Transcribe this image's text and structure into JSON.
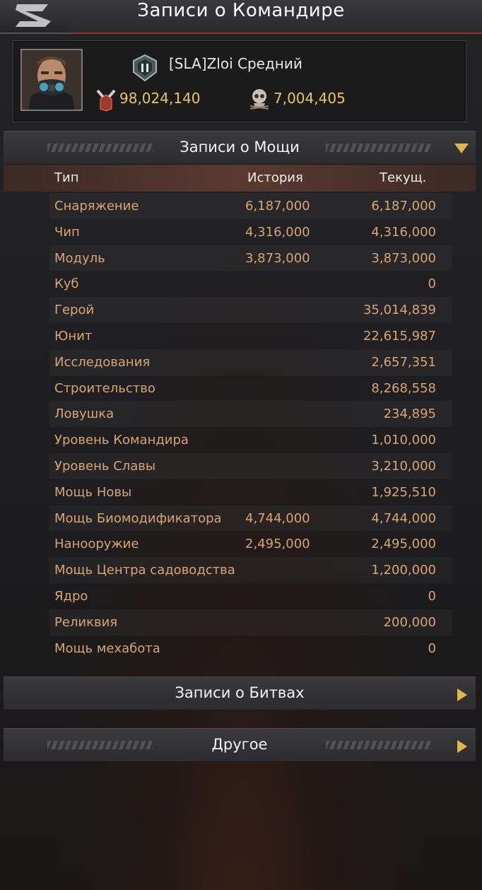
{
  "header": {
    "title": "Записи о Командире"
  },
  "profile": {
    "name": "[SLA]Zloi Средний",
    "power": "98,024,140",
    "kills": "7,004,405"
  },
  "power_section": {
    "title": "Записи о Мощи",
    "columns": {
      "type": "Тип",
      "history": "История",
      "current": "Текущ."
    },
    "rows": [
      {
        "type": "Снаряжение",
        "history": "6,187,000",
        "current": "6,187,000"
      },
      {
        "type": "Чип",
        "history": "4,316,000",
        "current": "4,316,000"
      },
      {
        "type": "Модуль",
        "history": "3,873,000",
        "current": "3,873,000"
      },
      {
        "type": "Куб",
        "history": "",
        "current": "0"
      },
      {
        "type": "Герой",
        "history": "",
        "current": "35,014,839"
      },
      {
        "type": "Юнит",
        "history": "",
        "current": "22,615,987"
      },
      {
        "type": "Исследования",
        "history": "",
        "current": "2,657,351"
      },
      {
        "type": "Строительство",
        "history": "",
        "current": "8,268,558"
      },
      {
        "type": "Ловушка",
        "history": "",
        "current": "234,895"
      },
      {
        "type": "Уровень Командира",
        "history": "",
        "current": "1,010,000"
      },
      {
        "type": "Уровень Славы",
        "history": "",
        "current": "3,210,000"
      },
      {
        "type": "Мощь Новы",
        "history": "",
        "current": "1,925,510"
      },
      {
        "type": "Мощь Биомодификатора",
        "history": "4,744,000",
        "current": "4,744,000"
      },
      {
        "type": "Нанооружие",
        "history": "2,495,000",
        "current": "2,495,000"
      },
      {
        "type": "Мощь Центра садоводства",
        "history": "",
        "current": "1,200,000"
      },
      {
        "type": "Ядро",
        "history": "",
        "current": "0"
      },
      {
        "type": "Реликвия",
        "history": "",
        "current": "200,000"
      },
      {
        "type": "Мощь мехабота",
        "history": "",
        "current": "0"
      }
    ]
  },
  "battle_section": {
    "title": "Записи о Битвах"
  },
  "other_section": {
    "title": "Другое"
  },
  "colors": {
    "gold": "#e5c66f",
    "row_text": "#d7a574",
    "arrow": "#e0b84a"
  },
  "icons": [
    "back-icon",
    "rank-icon",
    "power-icon",
    "kill-icon",
    "expand-arrow-icon",
    "collapse-arrow-icon"
  ]
}
